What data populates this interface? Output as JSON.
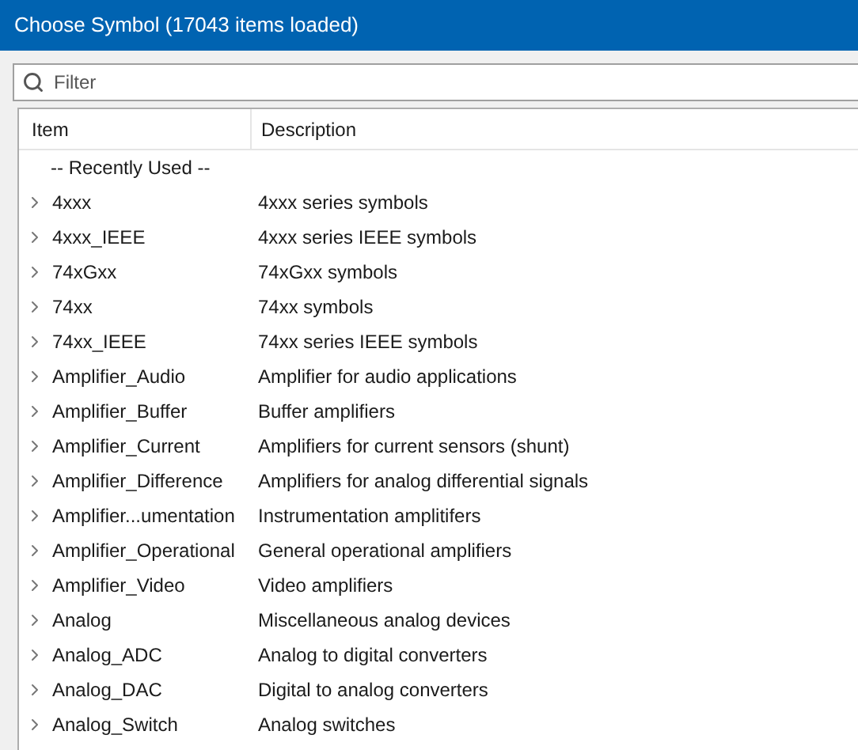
{
  "window": {
    "title": "Choose Symbol (17043 items loaded)"
  },
  "filter": {
    "placeholder": "Filter"
  },
  "table": {
    "columns": [
      "Item",
      "Description"
    ],
    "rows": [
      {
        "kind": "group",
        "item": "-- Recently Used --"
      },
      {
        "kind": "library",
        "item": "4xxx",
        "description": "4xxx series symbols",
        "expanded": false
      },
      {
        "kind": "library",
        "item": "4xxx_IEEE",
        "description": "4xxx series IEEE symbols",
        "expanded": false
      },
      {
        "kind": "library",
        "item": "74xGxx",
        "description": "74xGxx symbols",
        "expanded": false
      },
      {
        "kind": "library",
        "item": "74xx",
        "description": "74xx symbols",
        "expanded": false
      },
      {
        "kind": "library",
        "item": "74xx_IEEE",
        "description": "74xx series IEEE symbols",
        "expanded": false
      },
      {
        "kind": "library",
        "item": "Amplifier_Audio",
        "description": "Amplifier for audio applications",
        "expanded": false
      },
      {
        "kind": "library",
        "item": "Amplifier_Buffer",
        "description": "Buffer amplifiers",
        "expanded": false
      },
      {
        "kind": "library",
        "item": "Amplifier_Current",
        "description": "Amplifiers for current sensors (shunt)",
        "expanded": false
      },
      {
        "kind": "library",
        "item": "Amplifier_Difference",
        "description": "Amplifiers for analog differential signals",
        "expanded": false
      },
      {
        "kind": "library",
        "item": "Amplifier...umentation",
        "description": "Instrumentation amplitifers",
        "expanded": false
      },
      {
        "kind": "library",
        "item": "Amplifier_Operational",
        "description": "General operational amplifiers",
        "expanded": false
      },
      {
        "kind": "library",
        "item": "Amplifier_Video",
        "description": "Video amplifiers",
        "expanded": false
      },
      {
        "kind": "library",
        "item": "Analog",
        "description": "Miscellaneous analog devices",
        "expanded": false
      },
      {
        "kind": "library",
        "item": "Analog_ADC",
        "description": "Analog to digital converters",
        "expanded": false
      },
      {
        "kind": "library",
        "item": "Analog_DAC",
        "description": "Digital to analog converters",
        "expanded": false
      },
      {
        "kind": "library",
        "item": "Analog_Switch",
        "description": "Analog switches",
        "expanded": false
      }
    ]
  }
}
